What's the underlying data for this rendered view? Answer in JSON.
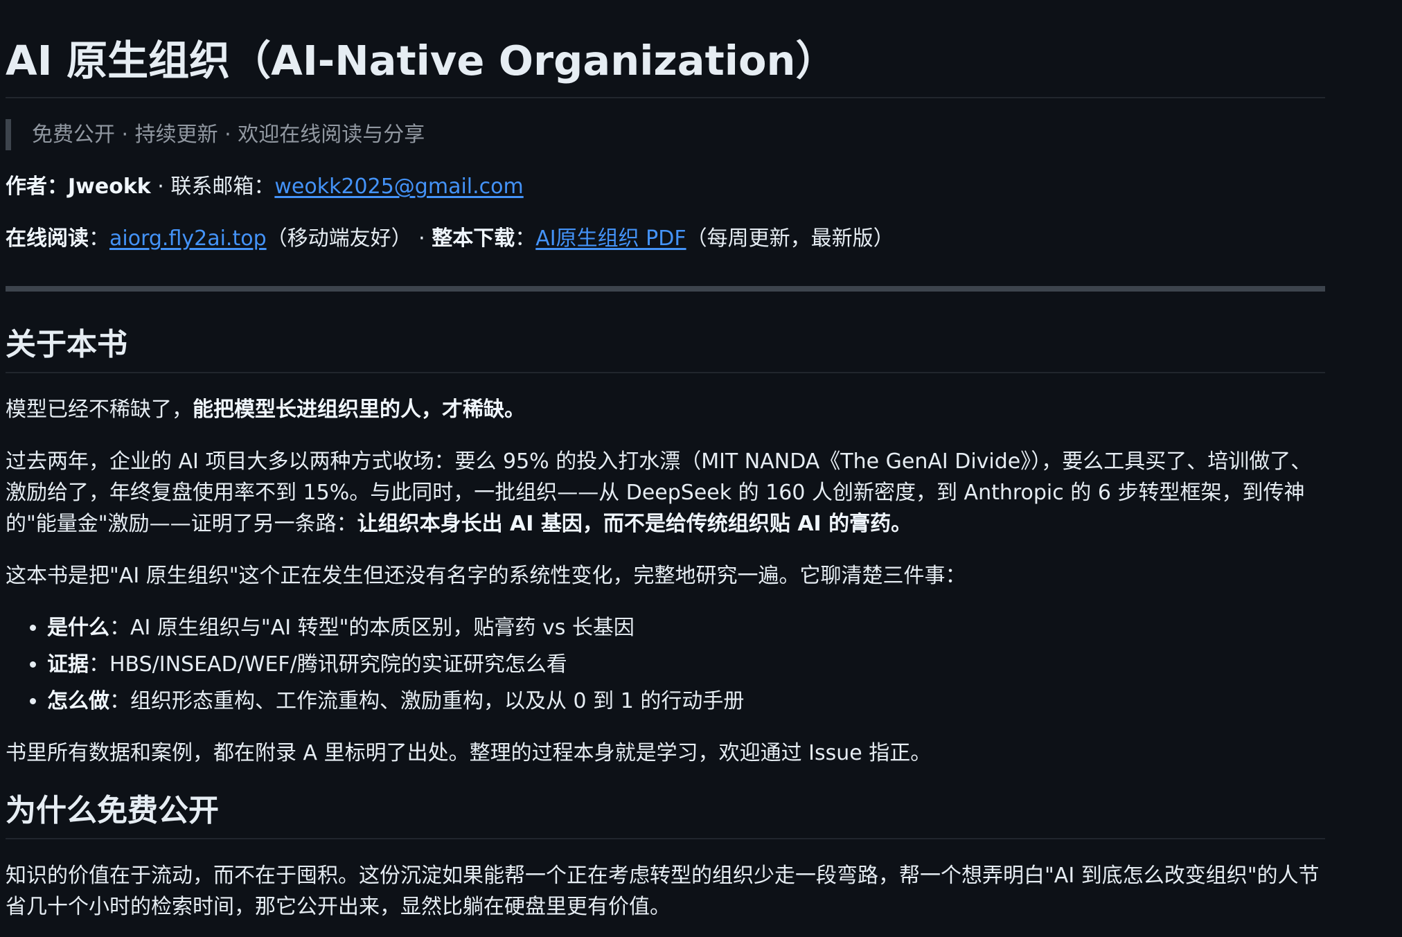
{
  "title": "AI 原生组织（AI-Native Organization）",
  "quote": "免费公开 · 持续更新 · 欢迎在线阅读与分享",
  "meta": {
    "author_label": "作者：",
    "author_name": "Jweokk",
    "contact_label": " · 联系邮箱：",
    "email": "weokk2025@gmail.com",
    "online_label": "在线阅读",
    "colon1": "：",
    "online_link": "aiorg.fly2ai.top",
    "online_note": "（移动端友好） · ",
    "download_label": "整本下载",
    "colon2": "：",
    "download_link": "AI原生组织 PDF",
    "download_note": "（每周更新，最新版）"
  },
  "section1": {
    "heading": "关于本书",
    "p1_text": "模型已经不稀缺了，",
    "p1_bold": "能把模型长进组织里的人，才稀缺。",
    "p2_text": "过去两年，企业的 AI 项目大多以两种方式收场：要么 95% 的投入打水漂（MIT NANDA《The GenAI Divide》），要么工具买了、培训做了、激励给了，年终复盘使用率不到 15%。与此同时，一批组织——从 DeepSeek 的 160 人创新密度，到 Anthropic 的 6 步转型框架，到传神的\"能量金\"激励——证明了另一条路：",
    "p2_bold": "让组织本身长出 AI 基因，而不是给传统组织贴 AI 的膏药。",
    "p3_text": "这本书是把\"AI 原生组织\"这个正在发生但还没有名字的系统性变化，完整地研究一遍。它聊清楚三件事：",
    "list": [
      {
        "label": "是什么",
        "text": "：AI 原生组织与\"AI 转型\"的本质区别，贴膏药 vs 长基因"
      },
      {
        "label": "证据",
        "text": "：HBS/INSEAD/WEF/腾讯研究院的实证研究怎么看"
      },
      {
        "label": "怎么做",
        "text": "：组织形态重构、工作流重构、激励重构，以及从 0 到 1 的行动手册"
      }
    ],
    "p4_text": "书里所有数据和案例，都在附录 A 里标明了出处。整理的过程本身就是学习，欢迎通过 Issue 指正。"
  },
  "section2": {
    "heading": "为什么免费公开",
    "p1_text": "知识的价值在于流动，而不在于囤积。这份沉淀如果能帮一个正在考虑转型的组织少走一段弯路，帮一个想弄明白\"AI 到底怎么改变组织\"的人节省几十个小时的检索时间，那它公开出来，显然比躺在硬盘里更有价值。"
  }
}
